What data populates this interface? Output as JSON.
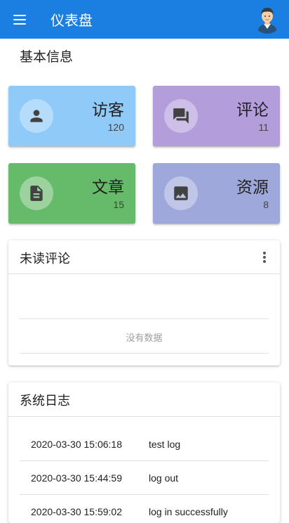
{
  "app_bar": {
    "title": "仪表盘",
    "menu_icon": "menu-icon",
    "avatar_icon": "user-avatar-icon"
  },
  "basic_info": {
    "title": "基本信息",
    "cards": [
      {
        "label": "访客",
        "value": "120",
        "icon": "person-icon",
        "color": "#90caf9"
      },
      {
        "label": "评论",
        "value": "11",
        "icon": "forum-icon",
        "color": "#b39ddb"
      },
      {
        "label": "文章",
        "value": "15",
        "icon": "document-icon",
        "color": "#66bb6a"
      },
      {
        "label": "资源",
        "value": "8",
        "icon": "image-icon",
        "color": "#9fa8da"
      }
    ]
  },
  "unread_comments": {
    "title": "未读评论",
    "more_icon": "more-vert-icon",
    "empty_text": "没有数据"
  },
  "system_log": {
    "title": "系统日志",
    "rows": [
      {
        "time": "2020-03-30 15:06:18",
        "message": "test log"
      },
      {
        "time": "2020-03-30 15:44:59",
        "message": "log out"
      },
      {
        "time": "2020-03-30 15:59:02",
        "message": "log in successfully"
      }
    ]
  }
}
